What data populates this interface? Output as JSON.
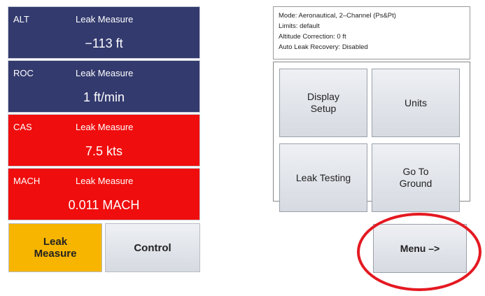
{
  "panels": [
    {
      "name": "ALT",
      "mode": "Leak Measure",
      "value": "−113 ft"
    },
    {
      "name": "ROC",
      "mode": "Leak Measure",
      "value": "1 ft/min"
    },
    {
      "name": "CAS",
      "mode": "Leak Measure",
      "value": "7.5 kts"
    },
    {
      "name": "MACH",
      "mode": "Leak Measure",
      "value": "0.011 MACH"
    }
  ],
  "bottom": {
    "leak_measure_label": "Leak Measure",
    "control_label": "Control"
  },
  "info": {
    "mode": "Mode: Aeronautical, 2–Channel (Ps&Pt)",
    "limits": "Limits: default",
    "altitude_correction": "Altitude Correction: 0 ft",
    "auto_leak_recovery": "Auto Leak Recovery: Disabled"
  },
  "grid": {
    "display_setup_label": "Display Setup",
    "units_label": "Units",
    "leak_testing_label": "Leak Testing",
    "go_to_ground_label": "Go To Ground"
  },
  "menu_label": "Menu –>",
  "colors": {
    "panel_navy": "#333a6e",
    "panel_red": "#f00d0d",
    "leak_measure_active": "#f7b500",
    "highlight_circle": "#e41921"
  }
}
